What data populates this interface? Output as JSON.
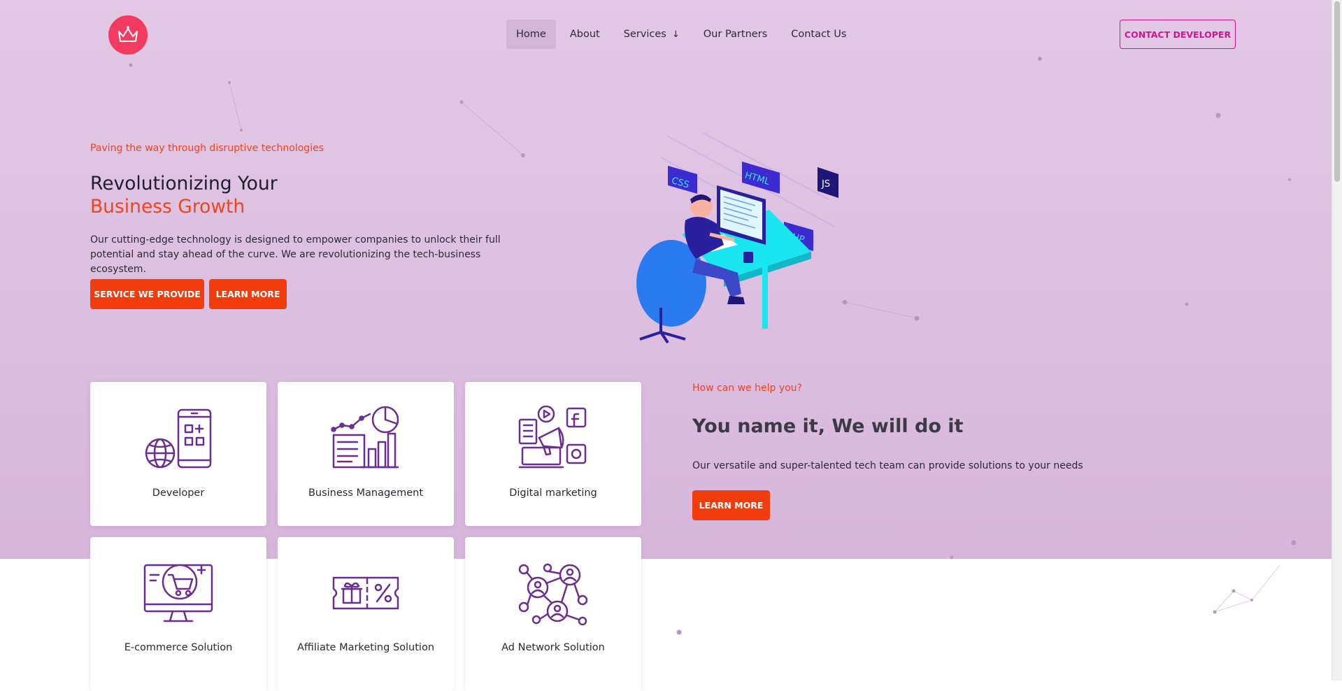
{
  "header": {
    "logo_icon": "crown-icon",
    "nav": [
      {
        "label": "Home",
        "active": true
      },
      {
        "label": "About"
      },
      {
        "label": "Services",
        "has_dropdown": true
      },
      {
        "label": "Our Partners"
      },
      {
        "label": "Contact Us"
      }
    ],
    "contact_button": "CONTACT DEVELOPER"
  },
  "hero": {
    "tagline": "Paving the way through disruptive technologies",
    "title_line1": "Revolutionizing Your",
    "title_line2": "Business Growth",
    "description": "Our cutting-edge technology is designed to empower companies to unlock their full potential and stay ahead of the curve. We are revolutionizing the tech-business ecosystem.",
    "primary_button": "SERVICE WE PROVIDE",
    "secondary_button": "LEARN MORE",
    "illustration": {
      "icon": "developer-at-desk-illustration",
      "badges": [
        "CSS",
        "HTML",
        "JS",
        "PHP"
      ]
    }
  },
  "services": [
    {
      "label": "Developer",
      "icon": "mobile-web-developer-icon"
    },
    {
      "label": "Business Management",
      "icon": "business-chart-icon"
    },
    {
      "label": "Digital marketing",
      "icon": "megaphone-marketing-icon"
    },
    {
      "label": "E-commerce Solution",
      "icon": "ecommerce-cart-monitor-icon"
    },
    {
      "label": "Affiliate Marketing Solution",
      "icon": "coupon-gift-icon"
    },
    {
      "label": "Ad Network Solution",
      "icon": "network-users-icon"
    }
  ],
  "help": {
    "tagline": "How can we help you?",
    "title": "You name it, We will do it",
    "description": "Our versatile and super-talented tech team can provide solutions to your needs",
    "button": "LEARN MORE"
  },
  "colors": {
    "accent_orange": "#f23c0c",
    "accent_pink": "#d4148a",
    "logo_red": "#f23b5e",
    "icon_purple": "#6b2d91",
    "hero_background": "#e0c4e3"
  }
}
